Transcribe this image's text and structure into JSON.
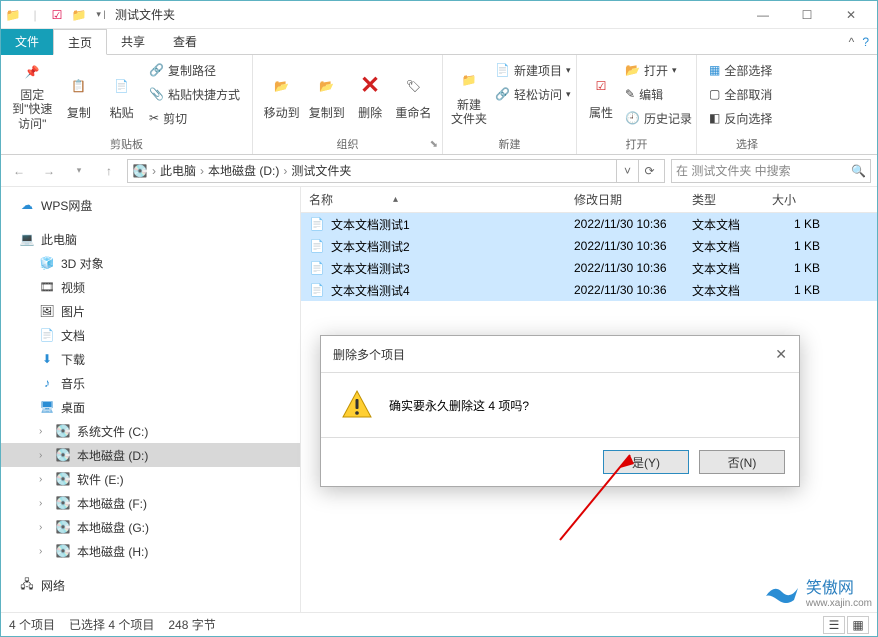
{
  "titlebar": {
    "title": "测试文件夹"
  },
  "tabs": {
    "file": "文件",
    "home": "主页",
    "share": "共享",
    "view": "查看"
  },
  "ribbon": {
    "clipboard": {
      "pin": "固定到\"快速访问\"",
      "copy": "复制",
      "paste": "粘贴",
      "copy_path": "复制路径",
      "paste_shortcut": "粘贴快捷方式",
      "cut": "剪切",
      "label": "剪贴板"
    },
    "organize": {
      "move_to": "移动到",
      "copy_to": "复制到",
      "delete": "删除",
      "rename": "重命名",
      "label": "组织"
    },
    "new": {
      "new_folder": "新建\n文件夹",
      "new_item": "新建项目",
      "easy_access": "轻松访问",
      "label": "新建"
    },
    "open": {
      "properties": "属性",
      "open": "打开",
      "edit": "编辑",
      "history": "历史记录",
      "label": "打开"
    },
    "select": {
      "select_all": "全部选择",
      "select_none": "全部取消",
      "invert": "反向选择",
      "label": "选择"
    }
  },
  "breadcrumb": {
    "items": [
      "此电脑",
      "本地磁盘 (D:)",
      "测试文件夹"
    ]
  },
  "search": {
    "placeholder": "在 测试文件夹 中搜索"
  },
  "sidebar": {
    "wps": "WPS网盘",
    "this_pc": "此电脑",
    "children": [
      "3D 对象",
      "视频",
      "图片",
      "文档",
      "下载",
      "音乐",
      "桌面",
      "系统文件 (C:)",
      "本地磁盘 (D:)",
      "软件 (E:)",
      "本地磁盘 (F:)",
      "本地磁盘 (G:)",
      "本地磁盘 (H:)"
    ],
    "network": "网络"
  },
  "columns": {
    "name": "名称",
    "date": "修改日期",
    "type": "类型",
    "size": "大小"
  },
  "files": [
    {
      "name": "文本文档测试1",
      "date": "2022/11/30 10:36",
      "type": "文本文档",
      "size": "1 KB"
    },
    {
      "name": "文本文档测试2",
      "date": "2022/11/30 10:36",
      "type": "文本文档",
      "size": "1 KB"
    },
    {
      "name": "文本文档测试3",
      "date": "2022/11/30 10:36",
      "type": "文本文档",
      "size": "1 KB"
    },
    {
      "name": "文本文档测试4",
      "date": "2022/11/30 10:36",
      "type": "文本文档",
      "size": "1 KB"
    }
  ],
  "dialog": {
    "title": "删除多个项目",
    "message": "确实要永久删除这 4 项吗?",
    "yes": "是(Y)",
    "no": "否(N)"
  },
  "status": {
    "items": "4 个项目",
    "selected": "已选择 4 个项目",
    "bytes": "248 字节"
  },
  "watermark": {
    "name": "笑傲网",
    "url": "www.xajin.com"
  }
}
